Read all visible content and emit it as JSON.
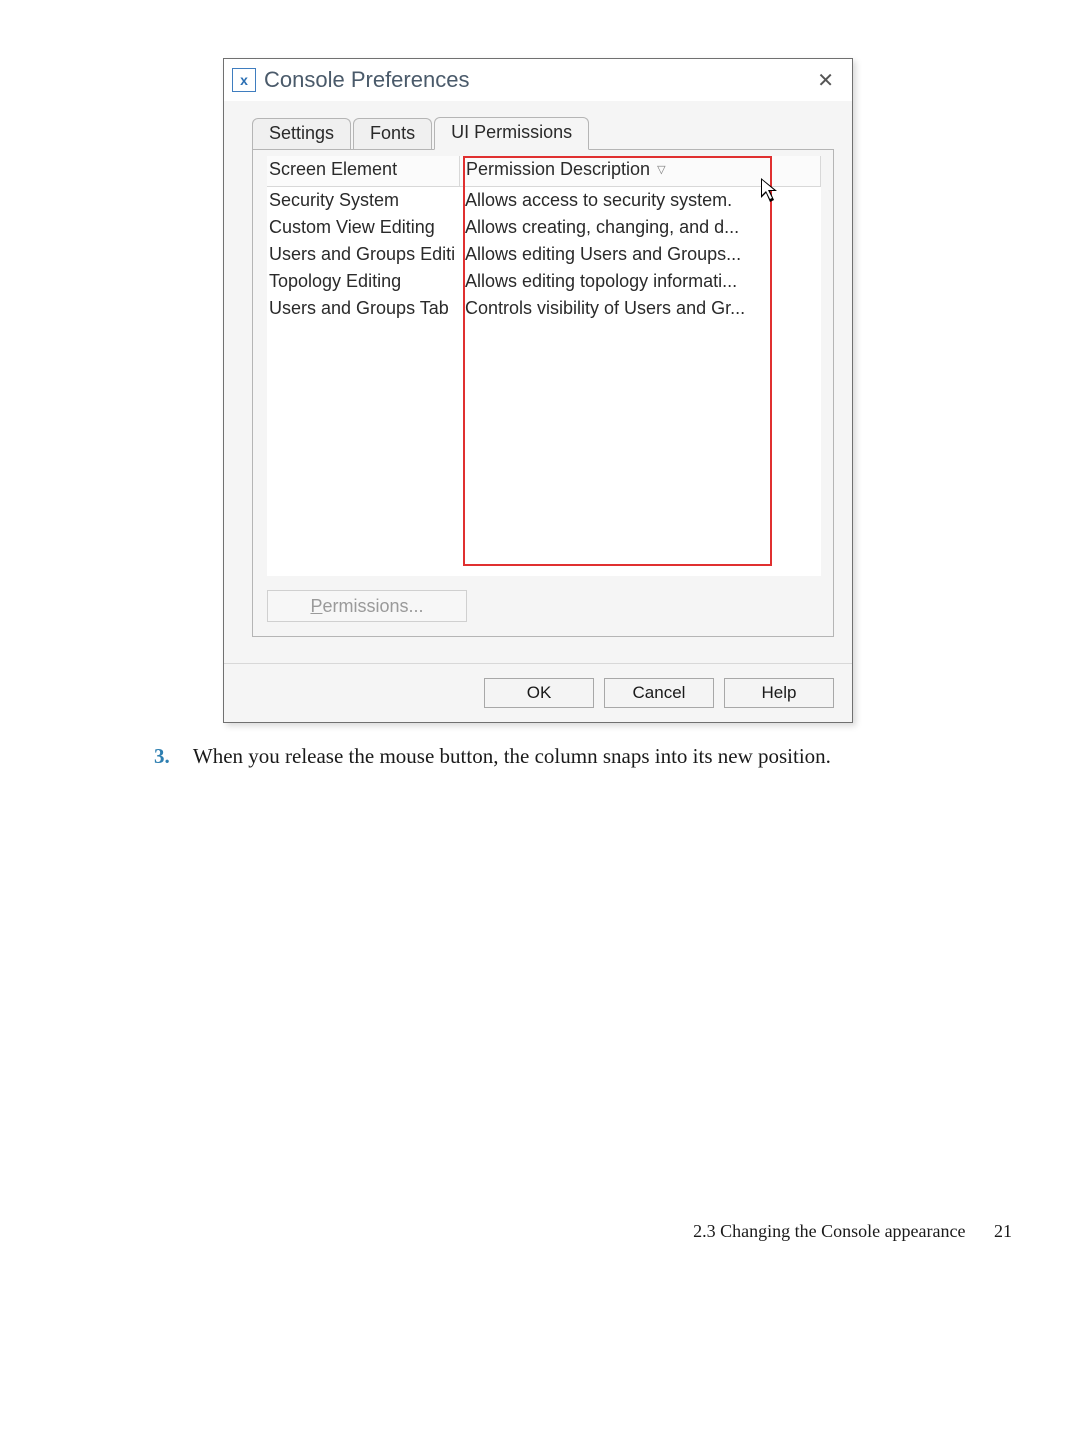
{
  "dialog": {
    "title": "Console Preferences",
    "close_glyph": "✕",
    "tabs": {
      "settings": "Settings",
      "fonts": "Fonts",
      "ui_permissions": "UI Permissions"
    },
    "columns": {
      "screen_element": "Screen Element",
      "permission_description": "Permission Description",
      "sort_indicator": "▽"
    },
    "rows": [
      {
        "element": "Security System",
        "desc": "Allows access to security system."
      },
      {
        "element": "Custom View Editing",
        "desc": "Allows creating, changing, and d..."
      },
      {
        "element": "Users and Groups Editi",
        "desc": "Allows editing Users and Groups..."
      },
      {
        "element": "Topology Editing",
        "desc": "Allows editing topology informati..."
      },
      {
        "element": "Users and Groups Tab",
        "desc": "Controls visibility of Users and Gr..."
      }
    ],
    "permissions_btn_prefix": "P",
    "permissions_btn_rest": "ermissions...",
    "buttons": {
      "ok": "OK",
      "cancel": "Cancel",
      "help": "Help"
    }
  },
  "doc": {
    "step_number": "3.",
    "step_text": "When you release the mouse button, the column snaps into its new position.",
    "footer_section": "2.3 Changing the Console appearance",
    "footer_page": "21"
  }
}
